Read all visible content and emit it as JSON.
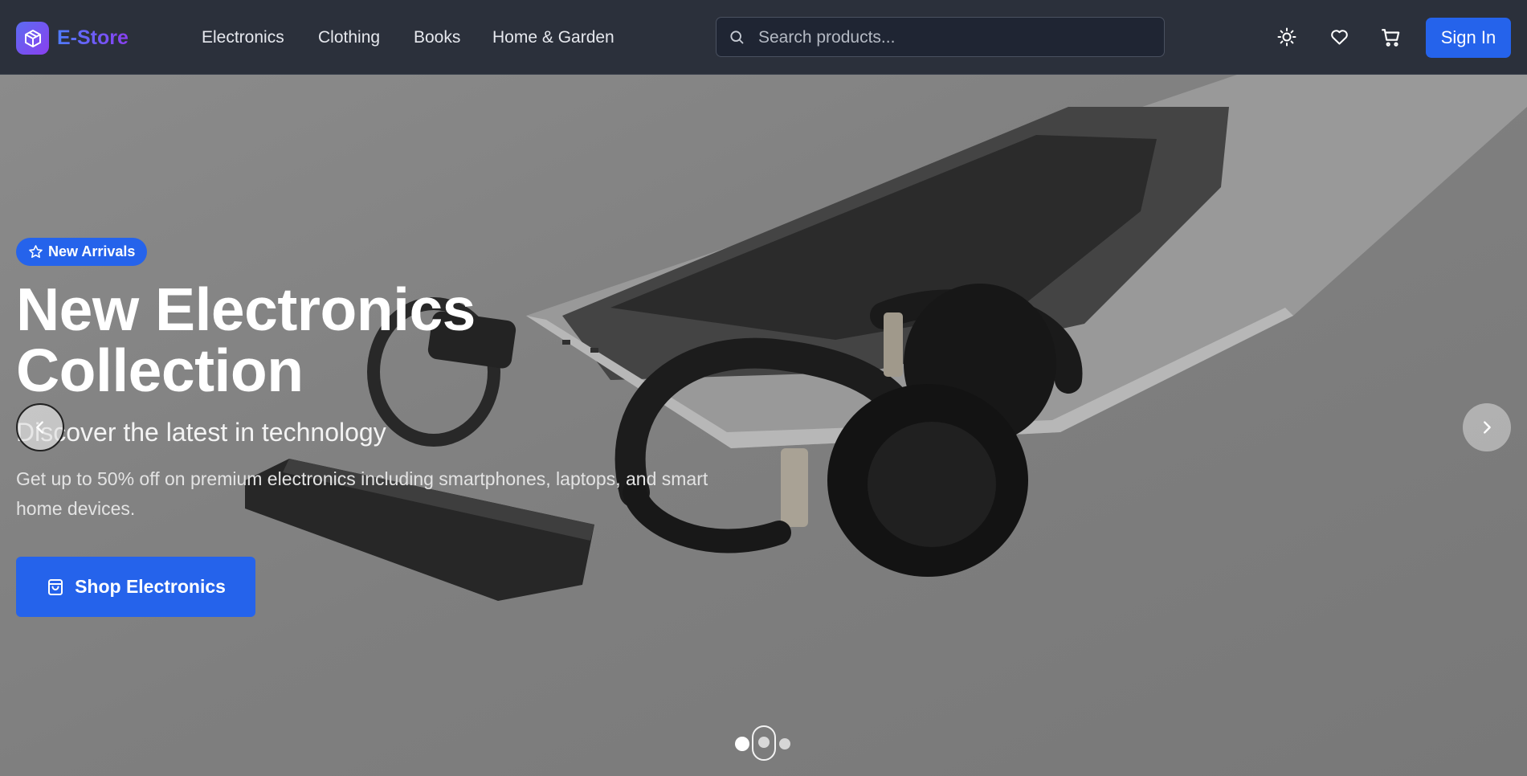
{
  "header": {
    "brand": "E-Store",
    "nav": [
      {
        "label": "Electronics"
      },
      {
        "label": "Clothing"
      },
      {
        "label": "Books"
      },
      {
        "label": "Home & Garden"
      }
    ],
    "search": {
      "placeholder": "Search products...",
      "value": ""
    },
    "icons": [
      "sun-icon",
      "heart-icon",
      "cart-icon"
    ],
    "signin_label": "Sign In"
  },
  "hero": {
    "badge": "New Arrivals",
    "title_line1": "New Electronics",
    "title_line2": "Collection",
    "subtitle": "Discover the latest in technology",
    "description": "Get up to 50% off on premium electronics including smartphones, laptops, and smart home devices.",
    "cta_label": "Shop Electronics",
    "slide_count": 3,
    "active_slide": 1
  },
  "colors": {
    "accent": "#2563eb",
    "header_bg": "#2b303b",
    "brand_gradient_start": "#4f7cff",
    "brand_gradient_end": "#8b3ff2"
  }
}
